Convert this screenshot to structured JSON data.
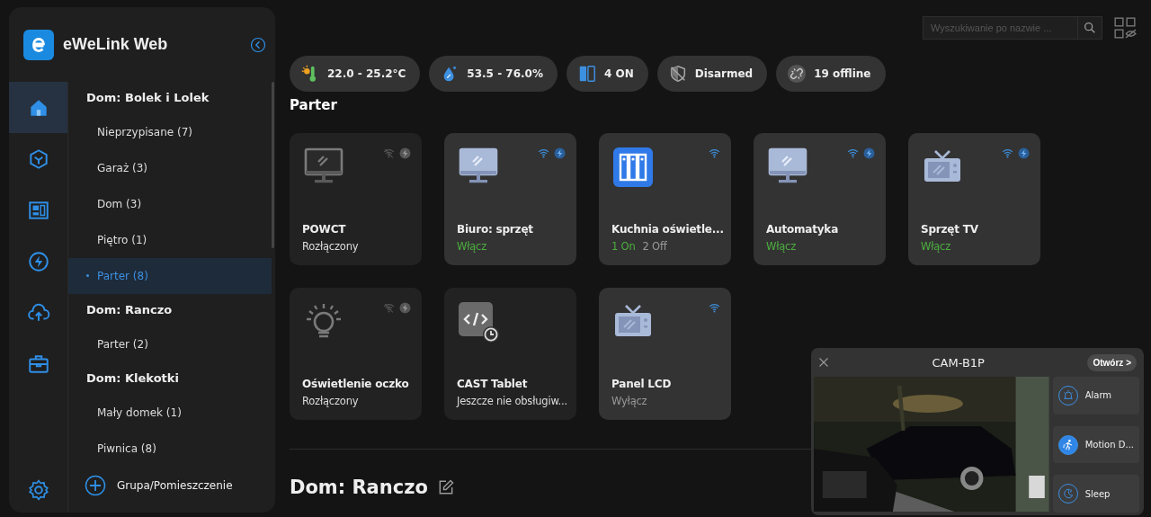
{
  "app": {
    "title": "eWeLink Web"
  },
  "rail": [
    {
      "selected": true
    },
    {
      "selected": false
    },
    {
      "selected": false
    },
    {
      "selected": false
    },
    {
      "selected": false
    },
    {
      "selected": false
    },
    {
      "selected": false
    }
  ],
  "homes": [
    {
      "name": "Dom: Bolek i Lolek",
      "rooms": [
        {
          "label": "Nieprzypisane  (7)",
          "selected": false
        },
        {
          "label": "Garaż  (3)",
          "selected": false
        },
        {
          "label": "Dom  (3)",
          "selected": false
        },
        {
          "label": "Piętro  (1)",
          "selected": false
        },
        {
          "label": "Parter  (8)",
          "selected": true
        }
      ]
    },
    {
      "name": "Dom: Ranczo",
      "rooms": [
        {
          "label": "Parter  (2)",
          "selected": false
        }
      ]
    },
    {
      "name": "Dom: Klekotki",
      "rooms": [
        {
          "label": "Mały domek  (1)",
          "selected": false
        },
        {
          "label": "Piwnica  (8)",
          "selected": false
        }
      ]
    }
  ],
  "add_group": {
    "label": "Grupa/Pomieszczenie"
  },
  "search": {
    "placeholder": "Wyszukiwanie po nazwie ..."
  },
  "stats": [
    {
      "label": "22.0 - 25.2°C"
    },
    {
      "label": "53.5 - 76.0%"
    },
    {
      "label": "4 ON"
    },
    {
      "label": "Disarmed"
    },
    {
      "label": "19 offline"
    }
  ],
  "section": {
    "title": "Parter"
  },
  "devices": [
    {
      "name": "POWCT",
      "kind": "monitor",
      "online": false,
      "wifi": true,
      "power": true,
      "status": [
        {
          "text": "Rozłączony",
          "on": false
        }
      ]
    },
    {
      "name": "Biuro: sprzęt",
      "kind": "monitor",
      "online": true,
      "wifi": true,
      "power": true,
      "status": [
        {
          "text": "Włącz",
          "on": true
        }
      ]
    },
    {
      "name": "Kuchnia oświetle...",
      "kind": "switch",
      "online": true,
      "wifi": true,
      "power": false,
      "status": [
        {
          "text": "1 On",
          "on": true
        },
        {
          "text": "2 Off",
          "on": false
        }
      ]
    },
    {
      "name": "Automatyka",
      "kind": "monitor",
      "online": true,
      "wifi": true,
      "power": true,
      "status": [
        {
          "text": "Włącz",
          "on": true
        }
      ]
    },
    {
      "name": "Sprzęt TV",
      "kind": "tv",
      "online": true,
      "wifi": true,
      "power": true,
      "status": [
        {
          "text": "Włącz",
          "on": true
        }
      ]
    },
    {
      "name": "Oświetlenie oczko",
      "kind": "bulb",
      "online": false,
      "wifi": true,
      "power": true,
      "status": [
        {
          "text": "Rozłączony",
          "on": false
        }
      ]
    },
    {
      "name": "CAST Tablet",
      "kind": "code",
      "online": false,
      "wifi": false,
      "power": false,
      "status": [
        {
          "text": "Jeszcze nie obsługiw...",
          "on": false
        }
      ]
    },
    {
      "name": "Panel LCD",
      "kind": "tv",
      "online": true,
      "wifi": true,
      "power": false,
      "status": [
        {
          "text": "Wyłącz",
          "on": false
        }
      ]
    }
  ],
  "next_section": {
    "title": "Dom: Ranczo"
  },
  "camera": {
    "title": "CAM-B1P",
    "open_label": "Otwórz >",
    "actions": [
      {
        "label": "Alarm",
        "on": false
      },
      {
        "label": "Motion D...",
        "on": true
      },
      {
        "label": "Sleep",
        "on": false
      }
    ]
  }
}
